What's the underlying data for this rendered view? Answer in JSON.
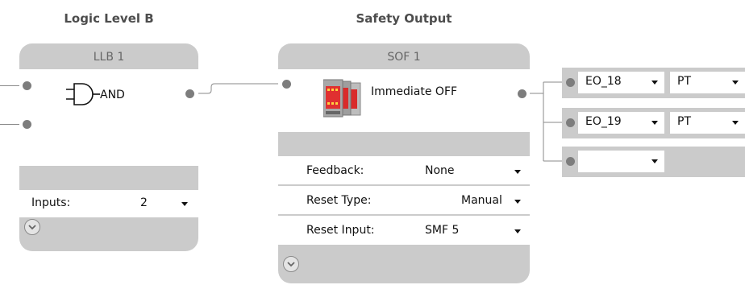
{
  "headings": {
    "logic": "Logic Level B",
    "safety": "Safety Output"
  },
  "llb": {
    "title": "LLB 1",
    "gate_label": "AND",
    "inputs_label": "Inputs:",
    "inputs_value": "2"
  },
  "sof": {
    "title": "SOF 1",
    "mode_label": "Immediate OFF",
    "params": [
      {
        "label": "Feedback:",
        "value": "None"
      },
      {
        "label": "Reset Type:",
        "value": "Manual"
      },
      {
        "label": "Reset Input:",
        "value": "SMF 5"
      }
    ]
  },
  "outputs": [
    {
      "output": "EO_18",
      "type": "PT"
    },
    {
      "output": "EO_19",
      "type": "PT"
    },
    {
      "output": "",
      "type": ""
    }
  ],
  "icons": [
    "and-gate-icon",
    "safety-relay-icon",
    "expand-chevron-icon",
    "dropdown-caret-icon"
  ],
  "colors": {
    "block_gray": "#cbcbcb",
    "port_gray": "#7d7d7d",
    "relay_red": "#d92b2b"
  }
}
